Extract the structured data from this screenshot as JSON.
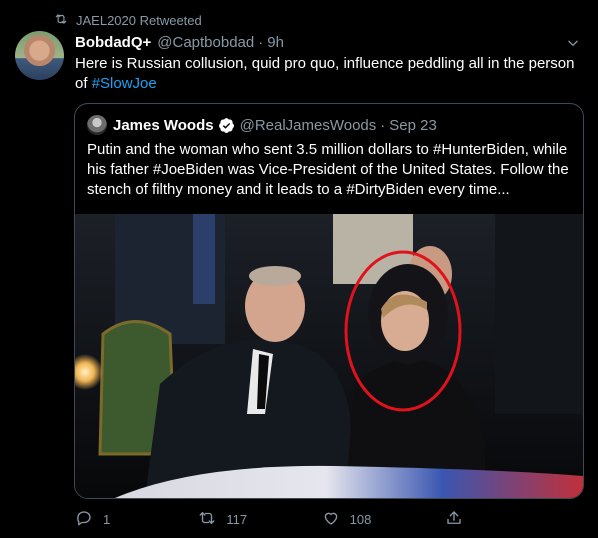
{
  "retweet_banner": {
    "icon": "retweet-icon",
    "text": "JAEL2020 Retweeted"
  },
  "tweet": {
    "display_name": "BobdadQ+",
    "handle": "@Captbobdad",
    "dot": "·",
    "time": "9h",
    "text_before": "Here is Russian collusion, quid pro quo, influence peddling all in the person of ",
    "hashtag": "#SlowJoe"
  },
  "quoted_tweet": {
    "display_name": "James Woods",
    "handle": "@RealJamesWoods",
    "dot": "·",
    "date": "Sep 23",
    "text": "Putin and the woman who sent 3.5 million dollars to #HunterBiden, while his father #JoeBiden was Vice-President of the United States. Follow the stench of filthy money and it leads to a #DirtyBiden every time..."
  },
  "actions": {
    "reply_count": "1",
    "retweet_count": "117",
    "like_count": "108"
  },
  "colors": {
    "background": "#000000",
    "accent": "#1da1f2",
    "muted": "#8899a6",
    "border": "#3d4a55",
    "highlight_circle": "#e0121b"
  }
}
